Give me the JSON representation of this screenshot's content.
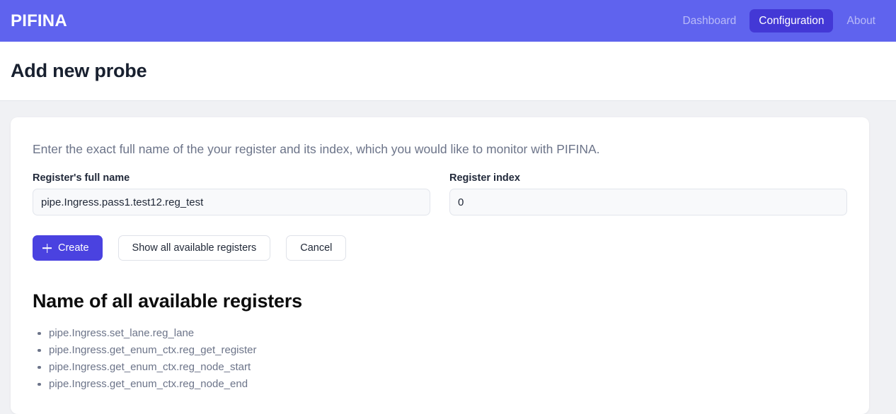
{
  "navbar": {
    "brand": "PIFINA",
    "links": [
      {
        "label": "Dashboard",
        "active": false
      },
      {
        "label": "Configuration",
        "active": true
      },
      {
        "label": "About",
        "active": false
      }
    ],
    "colors": {
      "background": "#5f63ee",
      "active_pill": "#4338d6",
      "text": "#ffffff",
      "text_muted": "rgba(255,255,255,0.56)"
    }
  },
  "page": {
    "title": "Add new probe",
    "background": "#f0f1f4"
  },
  "card": {
    "intro": "Enter the exact full name of the your register and its index, which you would like to monitor with PIFINA.",
    "fields": [
      {
        "label": "Register's full name",
        "value": "pipe.Ingress.pass1.test12.reg_test",
        "placeholder": "Register's full name"
      },
      {
        "label": "Register index",
        "value": "0",
        "placeholder": "Register index"
      }
    ],
    "buttons": {
      "create": {
        "label": "Create",
        "icon": "plus-icon",
        "color": "#4a42e0"
      },
      "show_all": {
        "label": "Show all available registers"
      },
      "cancel": {
        "label": "Cancel"
      }
    },
    "registers_section": {
      "title": "Name of all available registers",
      "items": [
        "pipe.Ingress.set_lane.reg_lane",
        "pipe.Ingress.get_enum_ctx.reg_get_register",
        "pipe.Ingress.get_enum_ctx.reg_node_start",
        "pipe.Ingress.get_enum_ctx.reg_node_end"
      ]
    }
  }
}
